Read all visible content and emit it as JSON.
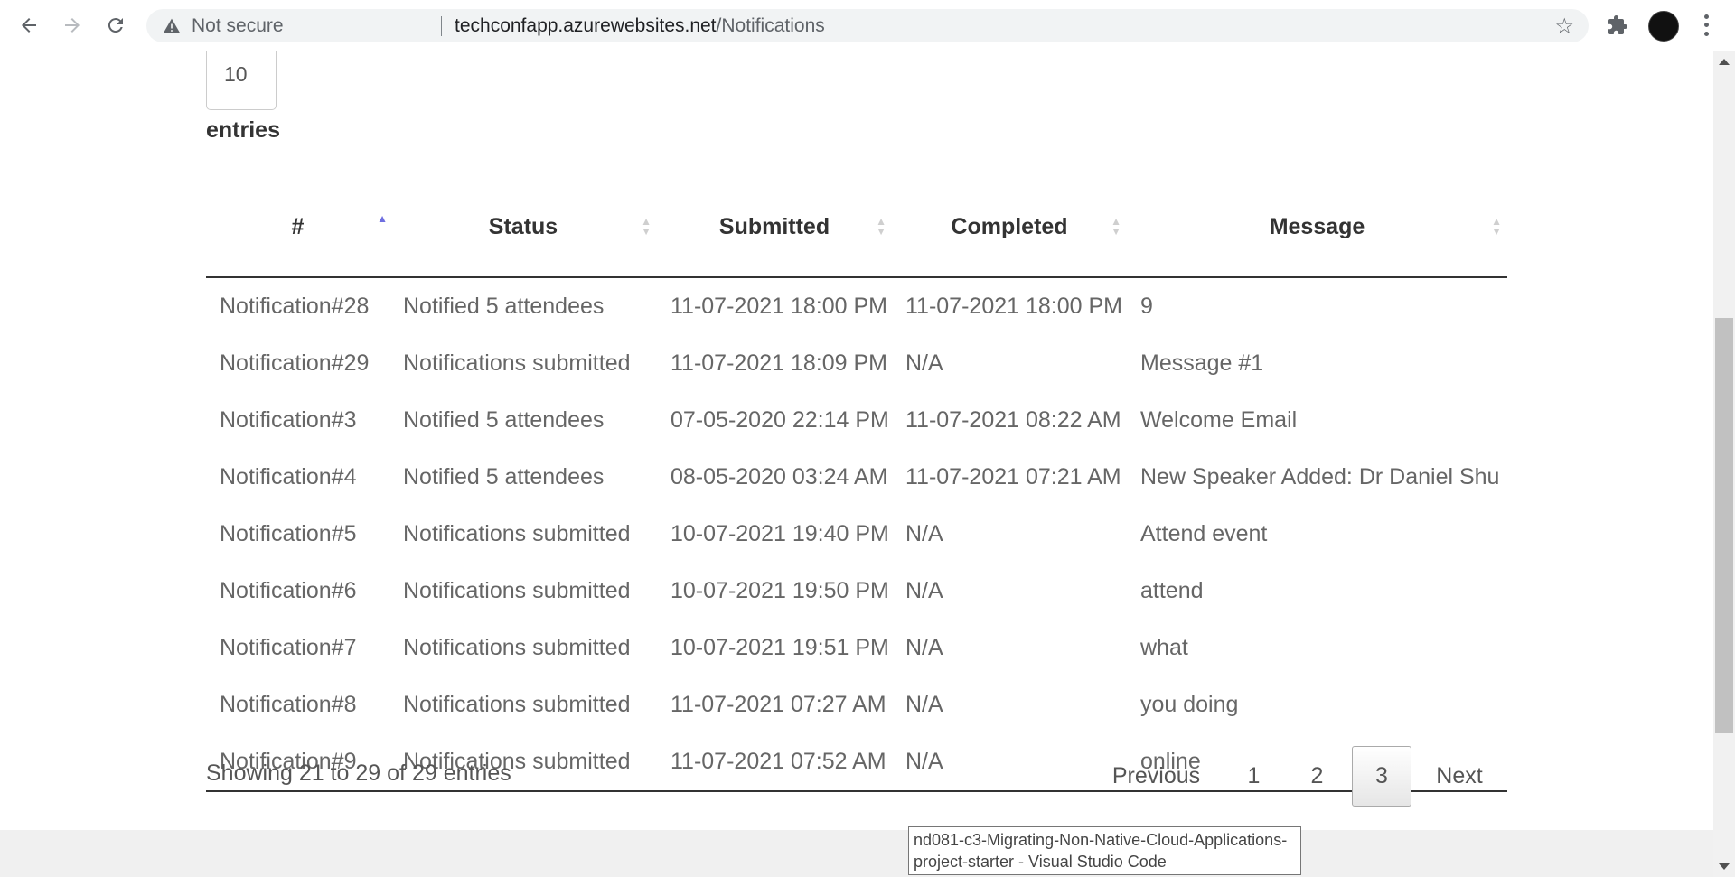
{
  "browser": {
    "security_label": "Not secure",
    "url_host": "techconfapp.azurewebsites.net",
    "url_path": "/Notifications"
  },
  "length_select": {
    "value": "10"
  },
  "entries_label": "entries",
  "table": {
    "columns": [
      "#",
      "Status",
      "Submitted",
      "Completed",
      "Message"
    ],
    "rows": [
      [
        "Notification#28",
        "Notified 5 attendees",
        "11-07-2021 18:00 PM",
        "11-07-2021 18:00 PM",
        "9"
      ],
      [
        "Notification#29",
        "Notifications submitted",
        "11-07-2021 18:09 PM",
        "N/A",
        "Message #1"
      ],
      [
        "Notification#3",
        "Notified 5 attendees",
        "07-05-2020 22:14 PM",
        "11-07-2021 08:22 AM",
        "Welcome Email"
      ],
      [
        "Notification#4",
        "Notified 5 attendees",
        "08-05-2020 03:24 AM",
        "11-07-2021 07:21 AM",
        "New Speaker Added: Dr Daniel Shu"
      ],
      [
        "Notification#5",
        "Notifications submitted",
        "10-07-2021 19:40 PM",
        "N/A",
        "Attend event"
      ],
      [
        "Notification#6",
        "Notifications submitted",
        "10-07-2021 19:50 PM",
        "N/A",
        "attend"
      ],
      [
        "Notification#7",
        "Notifications submitted",
        "10-07-2021 19:51 PM",
        "N/A",
        "what"
      ],
      [
        "Notification#8",
        "Notifications submitted",
        "11-07-2021 07:27 AM",
        "N/A",
        "you doing"
      ],
      [
        "Notification#9",
        "Notifications submitted",
        "11-07-2021 07:52 AM",
        "N/A",
        "online"
      ]
    ]
  },
  "info": "Showing 21 to 29 of 29 entries",
  "pagination": {
    "previous": "Previous",
    "pages": [
      "1",
      "2",
      "3"
    ],
    "current": "3",
    "next": "Next"
  },
  "tooltip": "nd081-c3-Migrating-Non-Native-Cloud-Applications-project-starter - Visual Studio Code",
  "colors": {
    "sort_active": "#6f6fe0",
    "sort_inactive": "#cfcfcf"
  }
}
